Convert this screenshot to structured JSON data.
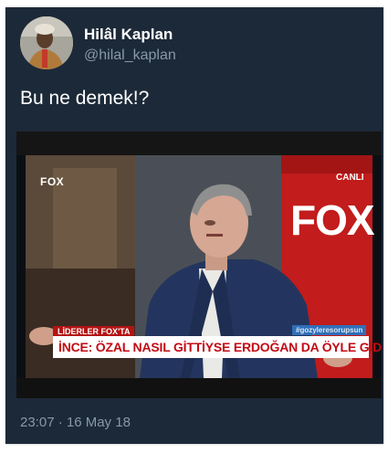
{
  "tweet": {
    "author_name": "Hilâl Kaplan",
    "author_handle": "@hilal_kaplan",
    "text": "Bu ne demek!?",
    "timestamp": "23:07 · 16 May 18"
  },
  "media": {
    "channel_logo": "FOX",
    "live_label": "CANLI",
    "backdrop_logo": "FOX",
    "program_tag": "LİDERLER FOX'TA",
    "hashtag_label": "#gozyleresorupsun",
    "headline": "İNCE: ÖZAL NASIL GİTTİYSE ERDOĞAN DA ÖYLE GİDECEK"
  },
  "colors": {
    "card_background": "#1c2938",
    "secondary_text": "#8899a6",
    "headline_red": "#c20a14"
  }
}
